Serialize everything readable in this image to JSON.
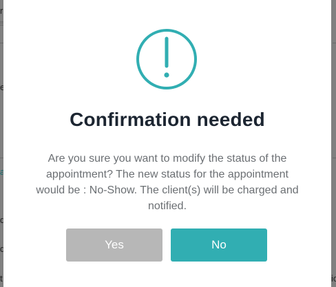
{
  "dialog": {
    "title": "Confirmation needed",
    "message": "Are you sure you want to modify the status of the appointment? The new status for the appointment would be : No-Show. The client(s) will be charged and notified.",
    "confirm_label": "Yes",
    "cancel_label": "No",
    "icon": "exclamation-circle-icon"
  },
  "background_fragments": {
    "left": [
      "r",
      "e",
      "e",
      "a",
      "d",
      "d",
      "t"
    ],
    "right": [
      "ic"
    ]
  },
  "colors": {
    "accent": "#31aeb2",
    "confirm_button": "#b7b7b7",
    "title": "#1c2531",
    "message": "#6b6f73",
    "overlay": "#808080"
  }
}
